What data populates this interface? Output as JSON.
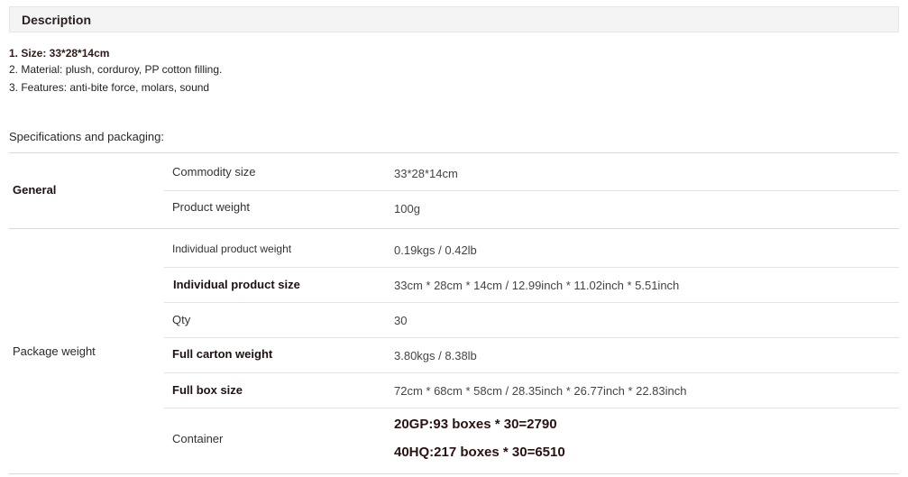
{
  "description": {
    "header": "Description",
    "lines": [
      "1. Size: 33*28*14cm",
      "2. Material: plush, corduroy, PP cotton filling.",
      "3. Features: anti-bite force, molars, sound"
    ]
  },
  "specs": {
    "title": "Specifications and packaging:",
    "general": {
      "label": "General",
      "rows": [
        {
          "name": "Commodity size",
          "value": "33*28*14cm"
        },
        {
          "name": "Product weight",
          "value": "100g"
        }
      ]
    },
    "package": {
      "label": "Package weight",
      "rows": [
        {
          "name": "Individual product weight",
          "value": "0.19kgs / 0.42lb"
        },
        {
          "name": "Individual product size",
          "value": "33cm * 28cm * 14cm / 12.99inch * 11.02inch * 5.51inch"
        },
        {
          "name": "Qty",
          "value": "30"
        },
        {
          "name": "Full carton weight",
          "value": "3.80kgs / 8.38lb"
        },
        {
          "name": "Full box size",
          "value": "72cm * 68cm * 58cm / 28.35inch * 26.77inch * 22.83inch"
        },
        {
          "name": "Container",
          "values": [
            "20GP:93 boxes * 30=2790",
            "40HQ:217 boxes * 30=6510"
          ]
        }
      ]
    }
  }
}
